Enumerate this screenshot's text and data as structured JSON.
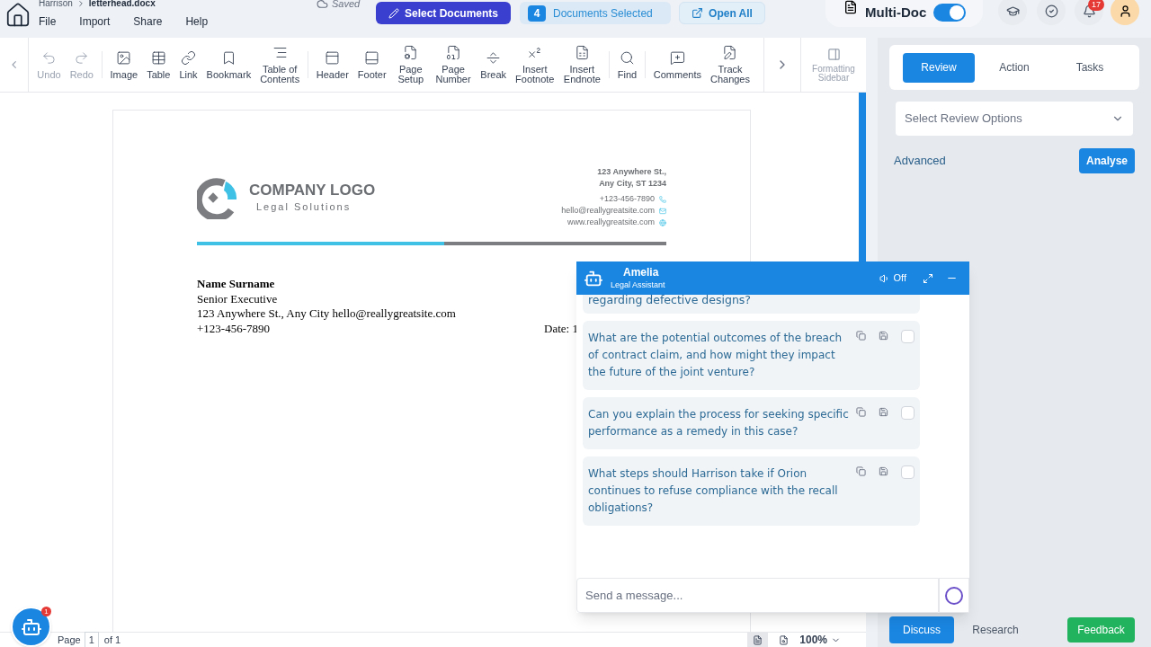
{
  "header": {
    "breadcrumb": {
      "folder": "Harrison",
      "file": "letterhead.docx"
    },
    "menu": [
      "File",
      "Import",
      "Share",
      "Help"
    ],
    "save_status": "Saved",
    "select_documents": "Select Documents",
    "selected_count": "4",
    "selected_label": "Documents Selected",
    "open_all": "Open All",
    "multi_doc": {
      "label": "Multi-Doc",
      "on": true
    },
    "notifications": "17"
  },
  "toolbar": {
    "groups": [
      [
        {
          "kind": "undo",
          "label": "Undo",
          "disabled": true
        },
        {
          "kind": "redo",
          "label": "Redo",
          "disabled": true
        }
      ],
      [
        {
          "kind": "image",
          "label": "Image",
          "disabled": false
        },
        {
          "kind": "table",
          "label": "Table",
          "disabled": false
        },
        {
          "kind": "link",
          "label": "Link",
          "disabled": false
        },
        {
          "kind": "bookmark",
          "label": "Bookmark",
          "disabled": false
        },
        {
          "kind": "toc",
          "label": "Table of Contents",
          "disabled": false
        }
      ],
      [
        {
          "kind": "header",
          "label": "Header",
          "disabled": false
        },
        {
          "kind": "footer",
          "label": "Footer",
          "disabled": false
        },
        {
          "kind": "pagesetup",
          "label": "Page Setup",
          "disabled": false
        },
        {
          "kind": "pagenumber",
          "label": "Page Number",
          "disabled": false
        },
        {
          "kind": "break",
          "label": "Break",
          "disabled": false
        },
        {
          "kind": "footnote",
          "label": "Insert Footnote",
          "disabled": false
        },
        {
          "kind": "endnote",
          "label": "Insert Endnote",
          "disabled": false
        }
      ],
      [
        {
          "kind": "find",
          "label": "Find",
          "disabled": false
        }
      ],
      [
        {
          "kind": "comments",
          "label": "Comments",
          "disabled": false
        },
        {
          "kind": "track",
          "label": "Track Changes",
          "disabled": false
        }
      ]
    ],
    "sidebar_toggle": {
      "label": "Formatting Sidebar",
      "disabled": true
    }
  },
  "document": {
    "logo_title": "COMPANY LOGO",
    "logo_subtitle": "Legal Solutions",
    "address": [
      "123 Anywhere St.,",
      "Any City, ST 1234"
    ],
    "contacts": [
      {
        "kind": "phone",
        "text": "+123-456-7890"
      },
      {
        "kind": "email",
        "text": "hello@reallygreatsite.com"
      },
      {
        "kind": "web",
        "text": "www.reallygreatsite.com"
      }
    ],
    "sender_name": "Name Surname",
    "sender_lines": [
      "Senior Executive",
      "123 Anywhere St., Any City hello@reallygreatsite.com",
      "+123-456-7890"
    ],
    "date": "Date: 1"
  },
  "status_bar": {
    "page_label": "Page",
    "page": "1",
    "of": "of 1",
    "zoom": "100%"
  },
  "chatbot_badge": "1",
  "chat": {
    "name": "Amelia",
    "role": "Legal Assistant",
    "sound": "Off",
    "partial": "regarding defective designs?",
    "questions": [
      {
        "text": "What are the potential outcomes of the breach of contract claim, and how might they impact the future of the joint venture?",
        "checked": false
      },
      {
        "text": "Can you explain the process for seeking specific performance as a remedy in this case?",
        "checked": false
      },
      {
        "text": "What steps should Harrison take if Orion continues to refuse compliance with the recall obligations?",
        "checked": false
      }
    ],
    "input_placeholder": "Send a message..."
  },
  "panel": {
    "tabs": [
      {
        "label": "Review",
        "selected": true
      },
      {
        "label": "Action",
        "selected": false
      },
      {
        "label": "Tasks",
        "selected": false
      }
    ],
    "select_placeholder": "Select Review Options",
    "advanced": "Advanced",
    "analyse": "Analyse",
    "bottom_tabs": [
      {
        "label": "Discuss",
        "selected": true
      },
      {
        "label": "Research",
        "selected": false
      }
    ],
    "feedback": "Feedback"
  }
}
